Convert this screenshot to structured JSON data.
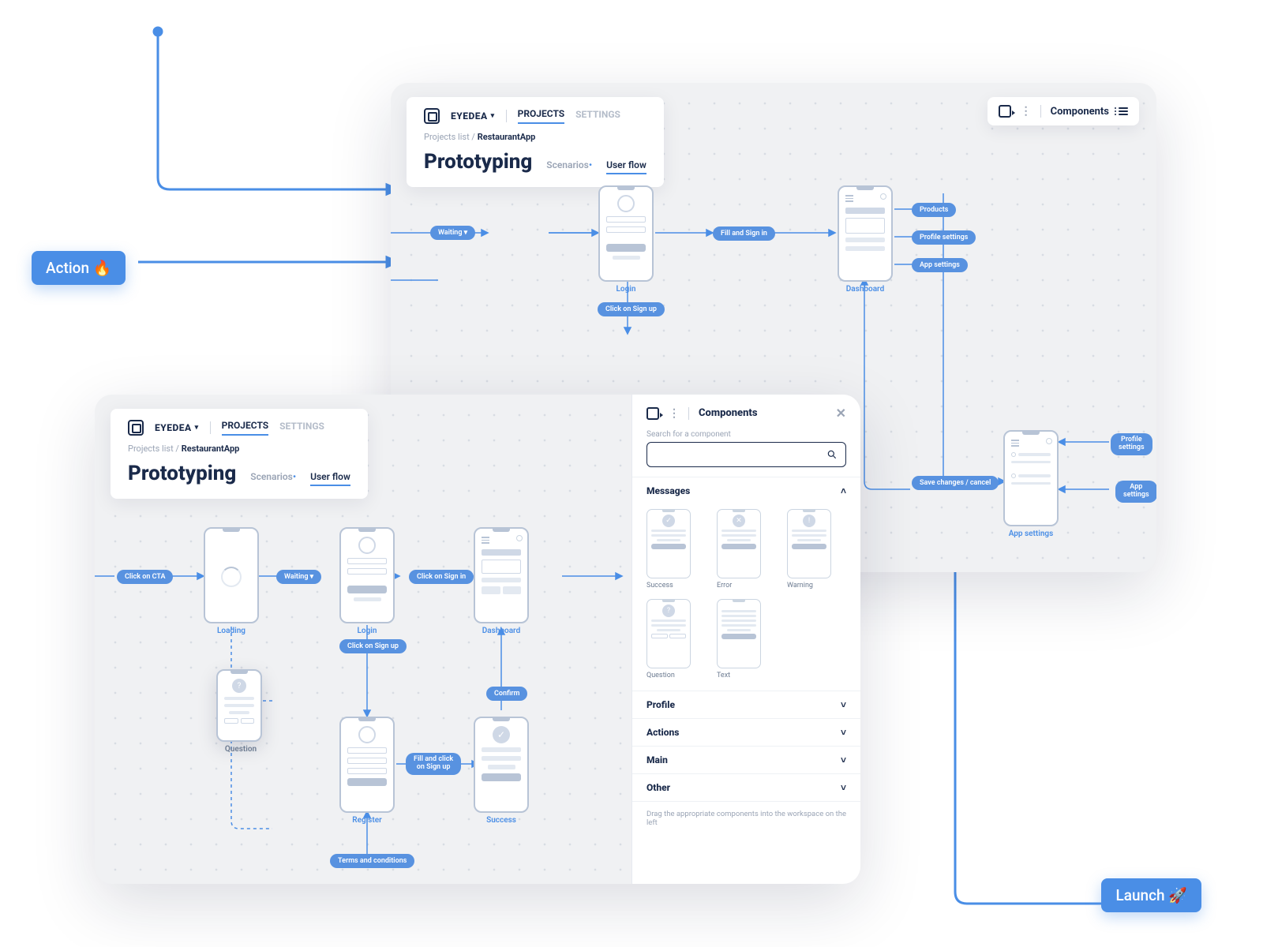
{
  "outer": {
    "action_label": "Action 🔥",
    "launch_label": "Launch 🚀"
  },
  "header": {
    "workspace": "EYEDEA",
    "tabs": {
      "projects": "PROJECTS",
      "settings": "SETTINGS"
    },
    "breadcrumb_list": "Projects list",
    "breadcrumb_sep": "/",
    "breadcrumb_current": "RestaurantApp",
    "title": "Prototyping",
    "subtabs": {
      "scenarios": "Scenarios",
      "userflow": "User flow"
    },
    "components_btn": "Components"
  },
  "flowA": {
    "waiting": "Waiting",
    "login": "Login",
    "fill_signin": "Fill and Sign in",
    "click_signup": "Click on Sign up",
    "dashboard": "Dashboard",
    "products": "Products",
    "profile_settings": "Profile settings",
    "app_settings": "App settings",
    "save_cancel": "Save changes / cancel",
    "app_settings_screen": "App settings"
  },
  "flowB": {
    "click_cta": "Click on CTA",
    "loading": "Loading",
    "waiting": "Waiting",
    "login": "Login",
    "click_signin": "Click on Sign in",
    "click_signup": "Click on Sign up",
    "dashboard": "Dashboard",
    "register": "Register",
    "fill_click_signup": "Fill and click\non Sign up",
    "terms": "Terms and conditions",
    "success": "Success",
    "confirm": "Confirm",
    "question": "Question"
  },
  "panel": {
    "title": "Components",
    "search_label": "Search for a component",
    "sections": {
      "messages": "Messages",
      "profile": "Profile",
      "actions": "Actions",
      "main": "Main",
      "other": "Other"
    },
    "thumbs": {
      "success": "Success",
      "error": "Error",
      "warning": "Warning",
      "question": "Question",
      "text": "Text"
    },
    "hint": "Drag the appropriate components into the workspace on the left"
  }
}
